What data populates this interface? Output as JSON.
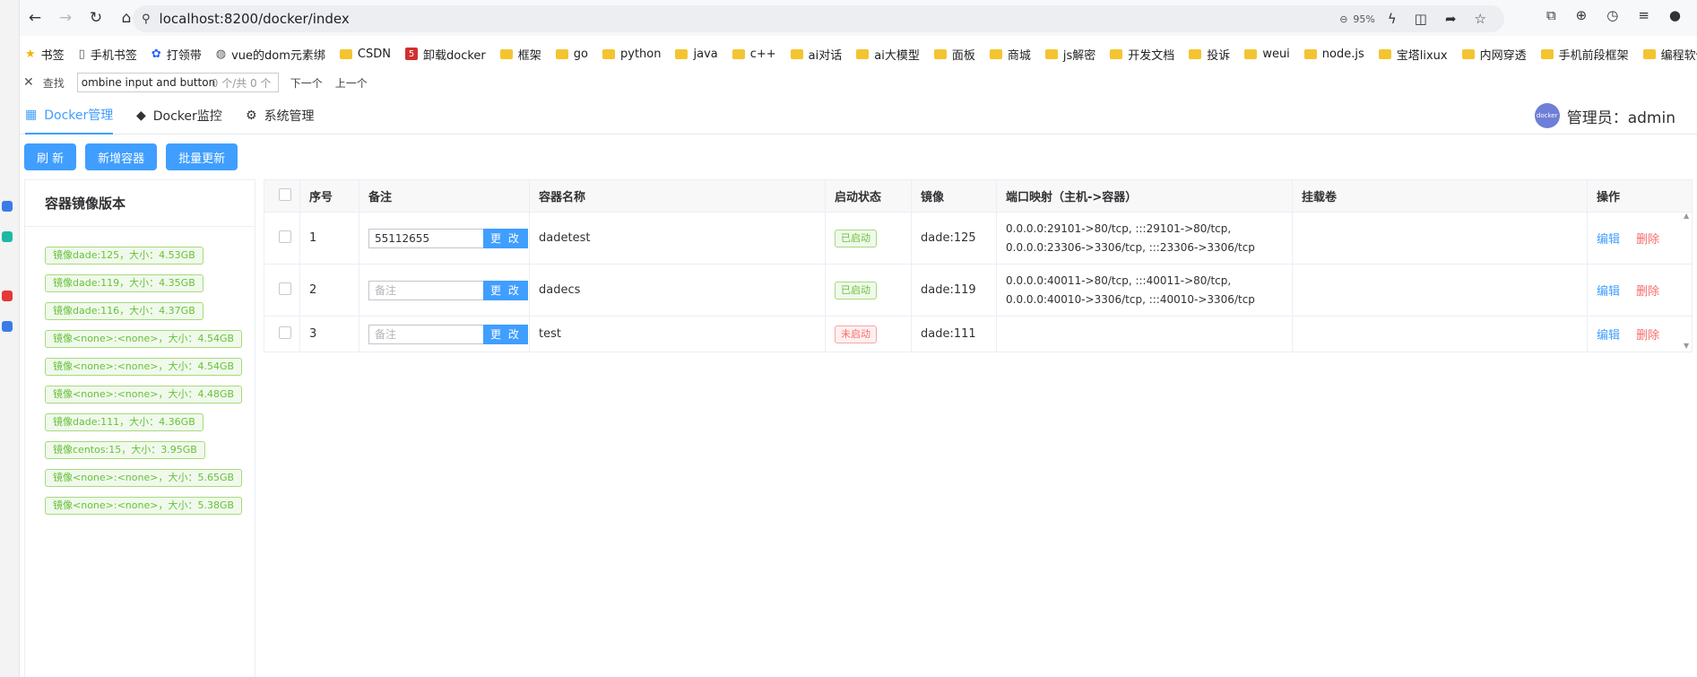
{
  "browser": {
    "url": "localhost:8200/docker/index",
    "zoom": "95%"
  },
  "bookmarks": [
    {
      "label": "书签",
      "icon": "star-icon"
    },
    {
      "label": "手机书签",
      "icon": "phone-icon"
    },
    {
      "label": "打领带",
      "icon": "paw-icon"
    },
    {
      "label": "vue的dom元素绑",
      "icon": "globe-icon"
    },
    {
      "label": "CSDN",
      "icon": "folder-icon"
    },
    {
      "label": "卸载docker",
      "icon": "site-51-icon"
    },
    {
      "label": "框架",
      "icon": "folder-icon"
    },
    {
      "label": "go",
      "icon": "folder-icon"
    },
    {
      "label": "python",
      "icon": "folder-icon"
    },
    {
      "label": "java",
      "icon": "folder-icon"
    },
    {
      "label": "c++",
      "icon": "folder-icon"
    },
    {
      "label": "ai对话",
      "icon": "folder-icon"
    },
    {
      "label": "ai大模型",
      "icon": "folder-icon"
    },
    {
      "label": "面板",
      "icon": "folder-icon"
    },
    {
      "label": "商城",
      "icon": "folder-icon"
    },
    {
      "label": "js解密",
      "icon": "folder-icon"
    },
    {
      "label": "开发文档",
      "icon": "folder-icon"
    },
    {
      "label": "投诉",
      "icon": "folder-icon"
    },
    {
      "label": "weui",
      "icon": "folder-icon"
    },
    {
      "label": "node.js",
      "icon": "folder-icon"
    },
    {
      "label": "宝塔lixux",
      "icon": "folder-icon"
    },
    {
      "label": "内网穿透",
      "icon": "folder-icon"
    },
    {
      "label": "手机前段框架",
      "icon": "folder-icon"
    },
    {
      "label": "编程软件",
      "icon": "folder-icon"
    }
  ],
  "findbar": {
    "label": "查找",
    "value": "ombine input and button",
    "count": "0 个/共 0 个",
    "next": "下一个",
    "prev": "上一个"
  },
  "nav": {
    "tabs": [
      "Docker管理",
      "Docker监控",
      "系统管理"
    ],
    "user_label": "管理员：admin",
    "avatar_text": "docker"
  },
  "toolbar": {
    "refresh": "刷 新",
    "add": "新增容器",
    "batch_update": "批量更新"
  },
  "image_panel": {
    "title": "容器镜像版本",
    "tags": [
      "镜像dade:125，大小：4.53GB",
      "镜像dade:119，大小：4.35GB",
      "镜像dade:116，大小：4.37GB",
      "镜像<none>:<none>，大小：4.54GB",
      "镜像<none>:<none>，大小：4.54GB",
      "镜像<none>:<none>，大小：4.48GB",
      "镜像dade:111，大小：4.36GB",
      "镜像centos:15，大小：3.95GB",
      "镜像<none>:<none>，大小：5.65GB",
      "镜像<none>:<none>，大小：5.38GB"
    ]
  },
  "table": {
    "headers": [
      "序号",
      "备注",
      "容器名称",
      "启动状态",
      "镜像",
      "端口映射（主机->容器）",
      "挂载卷",
      "操作"
    ],
    "note_placeholder": "备注",
    "update_label": "更 改",
    "edit_label": "编辑",
    "delete_label": "删除",
    "rows": [
      {
        "index": "1",
        "note": "55112655",
        "name": "dadetest",
        "status": "已启动",
        "image": "dade:125",
        "ports_line1": "0.0.0.0:29101->80/tcp, :::29101->80/tcp,",
        "ports_line2": "0.0.0.0:23306->3306/tcp, :::23306->3306/tcp",
        "volumes": ""
      },
      {
        "index": "2",
        "note": "",
        "name": "dadecs",
        "status": "已启动",
        "image": "dade:119",
        "ports_line1": "0.0.0.0:40011->80/tcp, :::40011->80/tcp,",
        "ports_line2": "0.0.0.0:40010->3306/tcp, :::40010->3306/tcp",
        "volumes": ""
      },
      {
        "index": "3",
        "note": "",
        "name": "test",
        "status": "未启动",
        "image": "dade:111",
        "ports_line1": "",
        "ports_line2": "",
        "volumes": ""
      }
    ]
  }
}
